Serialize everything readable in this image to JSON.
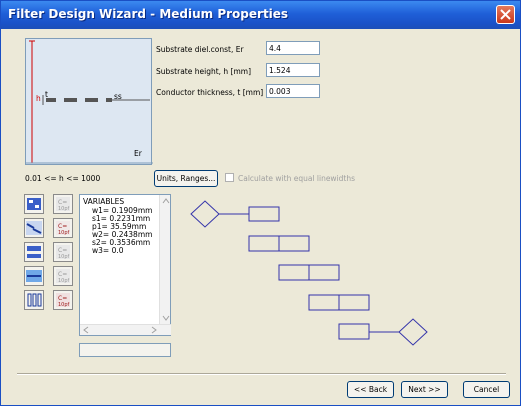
{
  "window": {
    "title": "Filter Design Wizard - Medium Properties"
  },
  "fields": [
    {
      "label": "Substrate diel.const, Er",
      "value": "4.4"
    },
    {
      "label": "Substrate height, h [mm]",
      "value": "1.524"
    },
    {
      "label": "Conductor thickness, t [mm]",
      "value": "0.003"
    }
  ],
  "diagram": {
    "h": "h",
    "t": "t",
    "ss": "ss",
    "er": "Er"
  },
  "range_text": "0.01 <= h <= 1000",
  "units_button": "Units, Ranges...",
  "equal_linewidths": {
    "label": "Calculate with equal linewidths",
    "checked": false
  },
  "variables": {
    "title": "VARIABLES",
    "lines": [
      "w1=   0.1909mm",
      "s1=   0.2231mm",
      "p1=   35.59mm",
      "w2=   0.2438mm",
      "s2=   0.3536mm",
      "w3=   0.0"
    ]
  },
  "buttons": {
    "back": "<< Back",
    "next": "Next >>",
    "cancel": "Cancel"
  },
  "colors": {
    "accent": "#1a4fc4",
    "shape_stroke": "#3333aa",
    "height_marker": "#d00000"
  }
}
